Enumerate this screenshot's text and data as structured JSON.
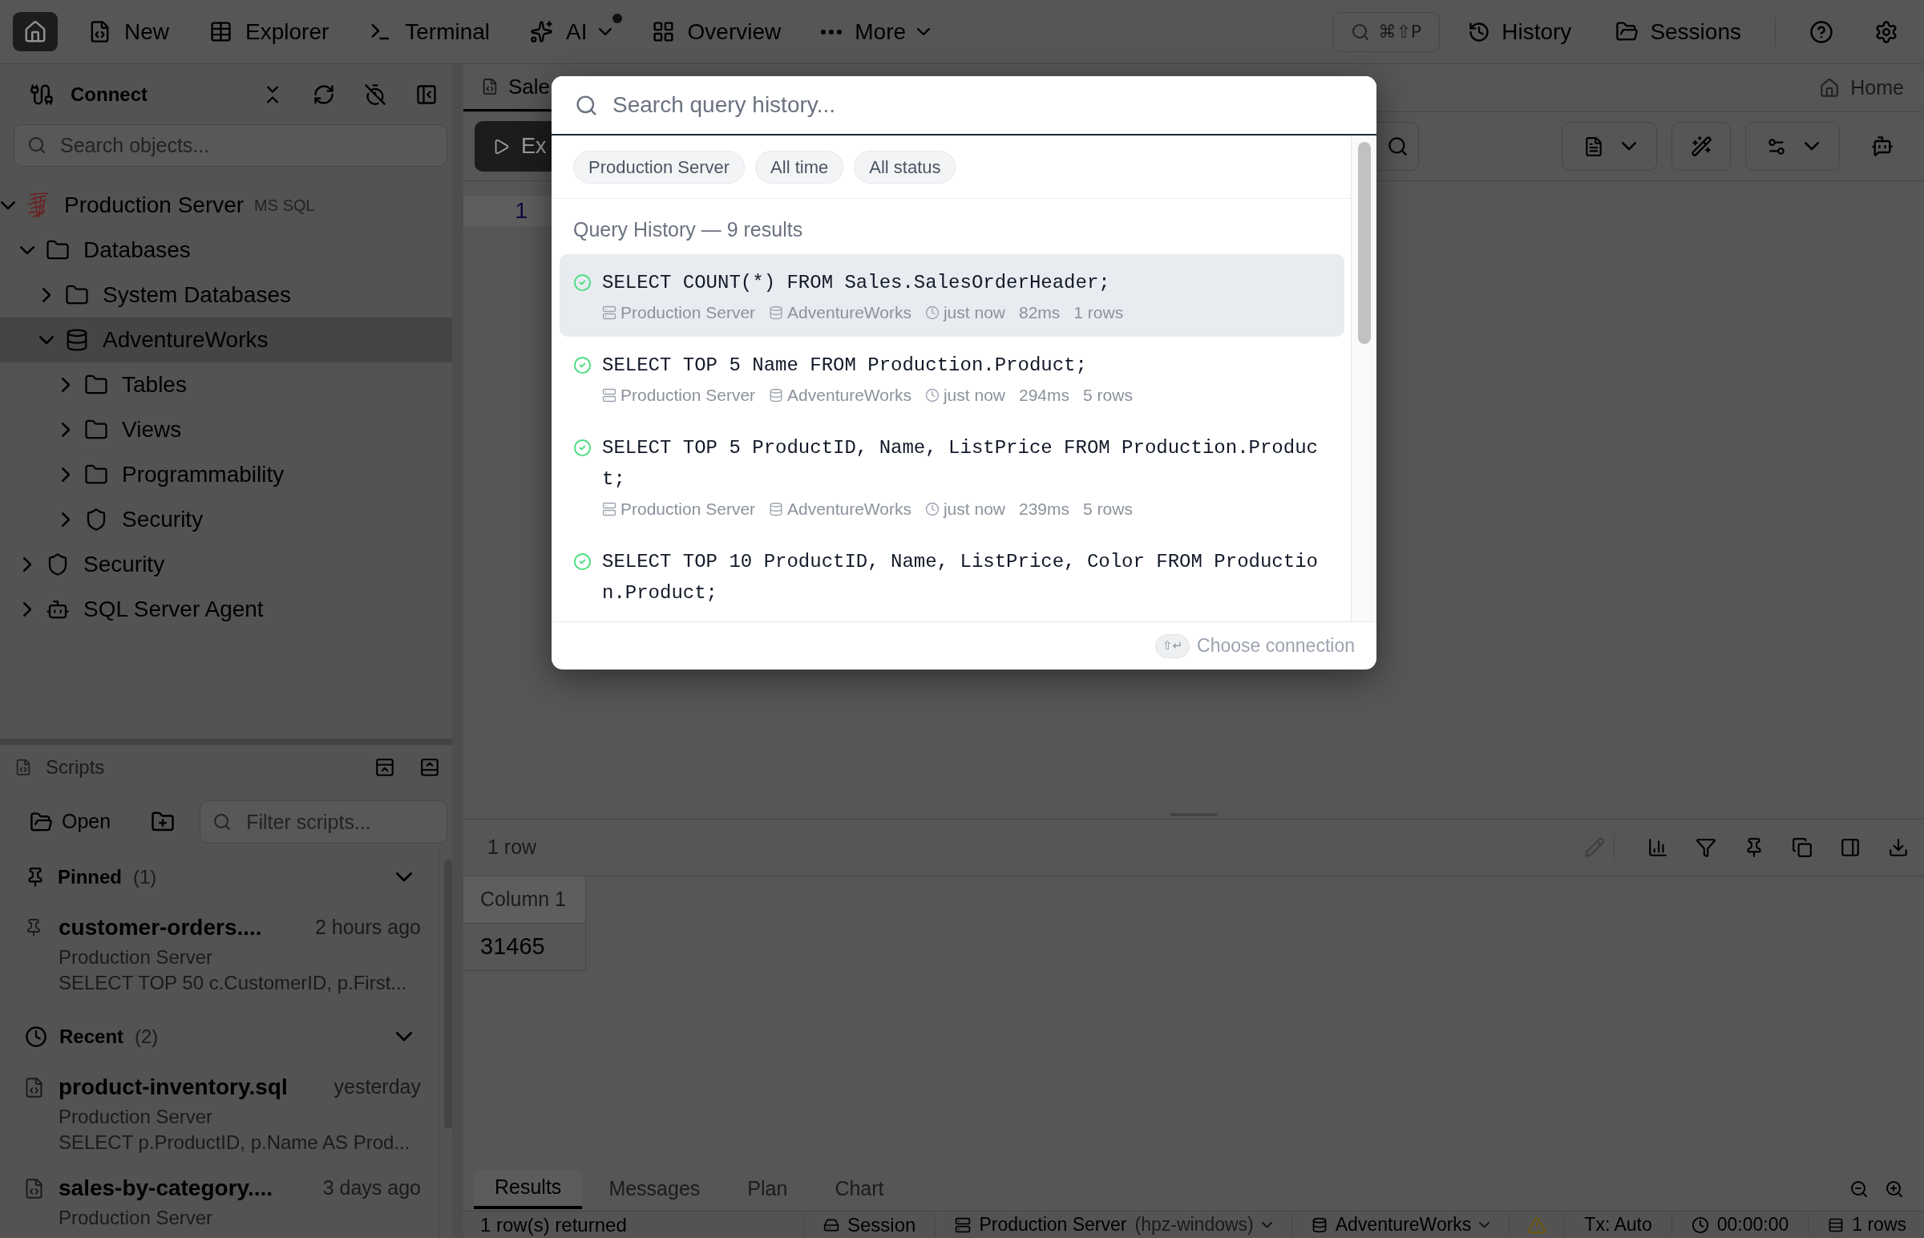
{
  "top_bar": {
    "nav": [
      {
        "kind": "home",
        "selected": true
      },
      {
        "kind": "page",
        "label": "New",
        "selected": false
      },
      {
        "kind": "page",
        "label": "Explorer",
        "selected": false
      },
      {
        "kind": "page",
        "label": "Terminal",
        "selected": false
      },
      {
        "kind": "menu",
        "label": "AI",
        "selected": false,
        "notification": true
      },
      {
        "kind": "page",
        "label": "Overview",
        "selected": false
      },
      {
        "kind": "menu",
        "label": "More",
        "selected": false
      }
    ],
    "quick_search": "⌘⇧P",
    "history": "History",
    "sessions": "Sessions"
  },
  "sidebar": {
    "title": "Connect",
    "search": {
      "placeholder": "Search objects..."
    },
    "tree": [
      {
        "label": "Production Server",
        "kind": "server",
        "badge": "MS SQL",
        "expanded": true,
        "selected": false,
        "children": [
          {
            "label": "Databases",
            "kind": "folder",
            "expanded": true,
            "selected": false,
            "children": [
              {
                "label": "System Databases",
                "kind": "folder",
                "expanded": false,
                "selected": false
              },
              {
                "label": "AdventureWorks",
                "kind": "database",
                "expanded": true,
                "selected": true,
                "children": [
                  {
                    "label": "Tables",
                    "kind": "folder",
                    "expanded": false,
                    "selected": false
                  },
                  {
                    "label": "Views",
                    "kind": "folder",
                    "expanded": false,
                    "selected": false
                  },
                  {
                    "label": "Programmability",
                    "kind": "folder",
                    "expanded": false,
                    "selected": false
                  },
                  {
                    "label": "Security",
                    "kind": "security",
                    "expanded": false,
                    "selected": false
                  }
                ]
              }
            ]
          },
          {
            "label": "Security",
            "kind": "security",
            "expanded": false,
            "selected": false
          },
          {
            "label": "SQL Server Agent",
            "kind": "agent",
            "expanded": false,
            "selected": false
          }
        ]
      }
    ]
  },
  "scripts": {
    "title": "Scripts",
    "open": "Open",
    "filter": {
      "placeholder": "Filter scripts..."
    },
    "groups": [
      {
        "kind": "pinned",
        "title": "Pinned",
        "count": "(1)",
        "expanded": true,
        "items": [
          {
            "name": "customer-orders....",
            "time": "2 hours ago",
            "server": "Production Server",
            "preview": "SELECT TOP 50 c.CustomerID, p.First..."
          }
        ]
      },
      {
        "kind": "recent",
        "title": "Recent",
        "count": "(2)",
        "expanded": true,
        "items": [
          {
            "name": "product-inventory.sql",
            "time": "yesterday",
            "server": "Production Server",
            "preview": "SELECT p.ProductID, p.Name AS Prod..."
          },
          {
            "name": "sales-by-category....",
            "time": "3 days ago",
            "server": "Production Server"
          }
        ]
      }
    ]
  },
  "editor": {
    "tab": {
      "label": "Sale",
      "selected": true
    },
    "home": "Home",
    "run_button": "Ex",
    "line_numbers": [
      "1"
    ]
  },
  "results": {
    "summary": "1 row",
    "edit_button": {
      "disabled": true
    },
    "columns": [
      "Column 1"
    ],
    "rows": [
      [
        "31465"
      ]
    ],
    "tabs": [
      {
        "label": "Results",
        "selected": true
      },
      {
        "label": "Messages",
        "selected": false
      },
      {
        "label": "Plan",
        "selected": false
      },
      {
        "label": "Chart",
        "selected": false
      }
    ]
  },
  "status_bar": {
    "message": "1 row(s) returned",
    "session": "Session",
    "server": "Production Server",
    "host": "(hpz-windows)",
    "database": "AdventureWorks",
    "transaction": "Tx: Auto",
    "elapsed": "00:00:00",
    "rows": "1 rows"
  },
  "history_dialog": {
    "search": {
      "placeholder": "Search query history..."
    },
    "filters": [
      "Production Server",
      "All time",
      "All status"
    ],
    "heading": "Query History — 9 results",
    "entries": [
      {
        "sql": "SELECT COUNT(*) FROM Sales.SalesOrderHeader;",
        "succeeded": true,
        "selected": true,
        "server": "Production Server",
        "database": "AdventureWorks",
        "time": "just now",
        "duration": "82ms",
        "rows": "1 rows"
      },
      {
        "sql": "SELECT TOP 5 Name FROM Production.Product;",
        "succeeded": true,
        "selected": false,
        "server": "Production Server",
        "database": "AdventureWorks",
        "time": "just now",
        "duration": "294ms",
        "rows": "5 rows"
      },
      {
        "sql": "SELECT TOP 5 ProductID, Name, ListPrice FROM Production.Product;",
        "succeeded": true,
        "selected": false,
        "server": "Production Server",
        "database": "AdventureWorks",
        "time": "just now",
        "duration": "239ms",
        "rows": "5 rows"
      },
      {
        "sql": "SELECT TOP 10 ProductID, Name, ListPrice, Color FROM Production.Product;",
        "succeeded": true,
        "selected": false
      }
    ],
    "footer": {
      "shortcut": "⇧↵",
      "action": "Choose connection"
    }
  }
}
